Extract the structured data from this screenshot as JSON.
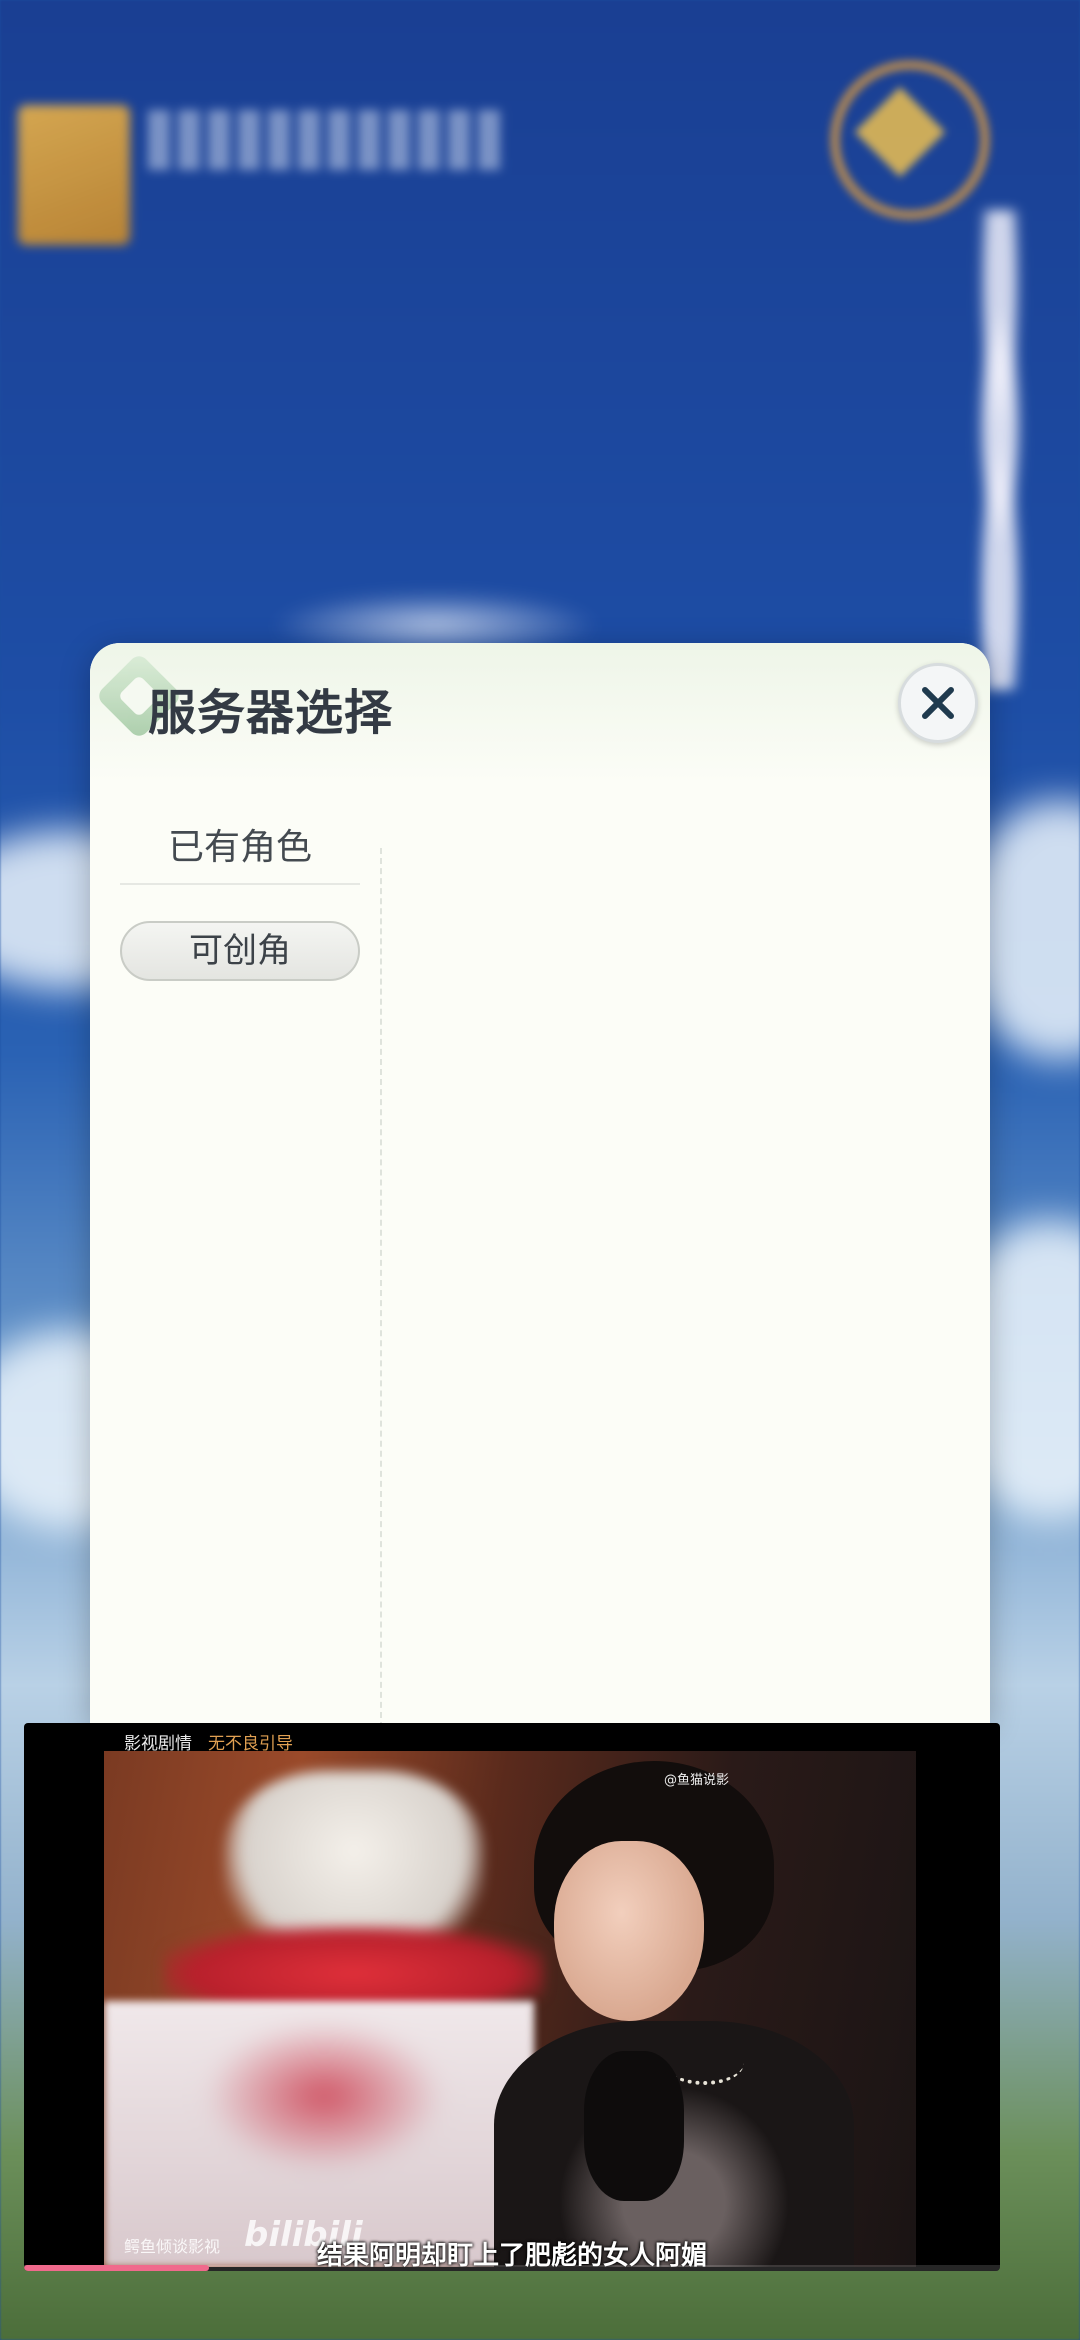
{
  "dialog": {
    "title": "服务器选择",
    "tabs": [
      {
        "label": "已有角色",
        "selected": false
      },
      {
        "label": "可创角",
        "selected": true
      }
    ]
  },
  "video": {
    "top_label": "影视剧情",
    "top_warning": "无不良引导",
    "frame_watermark": "@鱼猫说影",
    "channel_watermark": "鳄鱼倾谈影视",
    "platform_logo": "bilibili",
    "subtitle": "结果阿明却盯上了肥彪的女人阿媚",
    "progress": 0.19
  },
  "colors": {
    "dialog_bg": "#fcfdf7",
    "title_text": "#333a44",
    "progress_accent": "#f06a8c",
    "warning_text": "#e0a052"
  }
}
